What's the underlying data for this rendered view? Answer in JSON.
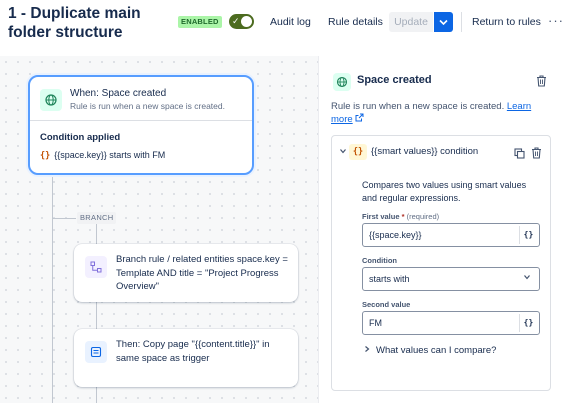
{
  "header": {
    "title": "1 - Duplicate main folder structure",
    "status_badge": "ENABLED",
    "audit_log": "Audit log",
    "rule_details": "Rule details",
    "update": "Update",
    "return_to_rules": "Return to rules",
    "more": "···"
  },
  "canvas": {
    "trigger": {
      "title": "When: Space created",
      "subtitle": "Rule is run when a new space is created.",
      "condition_heading": "Condition applied",
      "condition_text": "{{space.key}} starts with FM"
    },
    "branch_label": "BRANCH",
    "branch_node": {
      "text": "Branch rule / related entities space.key = Template AND title = \"Project Progress Overview\""
    },
    "action_node": {
      "text": "Then: Copy page \"{{content.title}}\" in same space as trigger"
    }
  },
  "panel": {
    "title": "Space created",
    "description": "Rule is run when a new space is created.",
    "learn_more": "Learn more",
    "condition": {
      "brace_icon": "{}",
      "title": "{{smart values}} condition",
      "description": "Compares two values using smart values and regular expressions.",
      "first_value_label": "First value",
      "required_mark": "*",
      "required_text": "(required)",
      "first_value": "{{space.key}}",
      "condition_label": "Condition",
      "condition_value": "starts with",
      "second_value_label": "Second value",
      "second_value": "FM",
      "compare_link": "What values can I compare?"
    }
  },
  "colors": {
    "accent": "#0c66e4",
    "toggle": "#4c6b1f",
    "badge_bg": "#abf5a8",
    "trigger_border": "#579dff"
  }
}
